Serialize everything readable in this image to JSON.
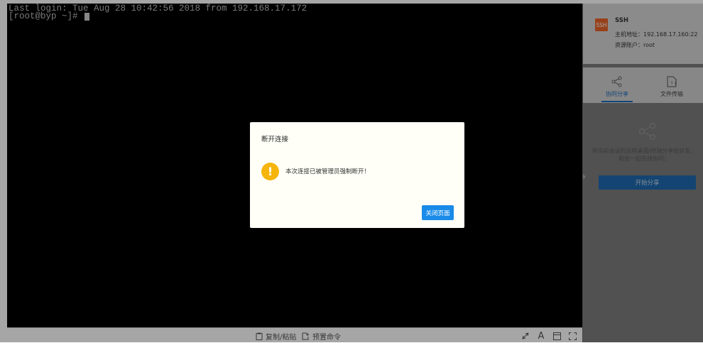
{
  "terminal": {
    "lines": [
      "Last login: Tue Aug 28 10:42:56 2018 from 192.168.17.172",
      "[root@byp ~]# "
    ]
  },
  "bottom_bar": {
    "copy_paste": "复制/粘贴",
    "preset_commands": "预置命令",
    "font_icon_label": "A"
  },
  "session": {
    "badge": "SSH",
    "title": "SSH",
    "host_label": "主机地址：192.168.17.160:22",
    "account_label": "资源账户：root"
  },
  "tabs": [
    {
      "label": "协同分享",
      "icon": "share-icon",
      "active": true
    },
    {
      "label": "文件传输",
      "icon": "file-icon",
      "active": false
    }
  ],
  "share": {
    "description": "将当前会话的远程桌面/终端分享给好友，和您一起在线协同；",
    "button": "开始分享"
  },
  "dialog": {
    "title": "断开连接",
    "message": "本次连接已被管理员强制断开！",
    "icon": "warning-icon",
    "button": "关闭页面"
  },
  "colors": {
    "accent": "#1a8be8",
    "warning": "#f5b50c",
    "ssh_badge": "#e8642a"
  }
}
